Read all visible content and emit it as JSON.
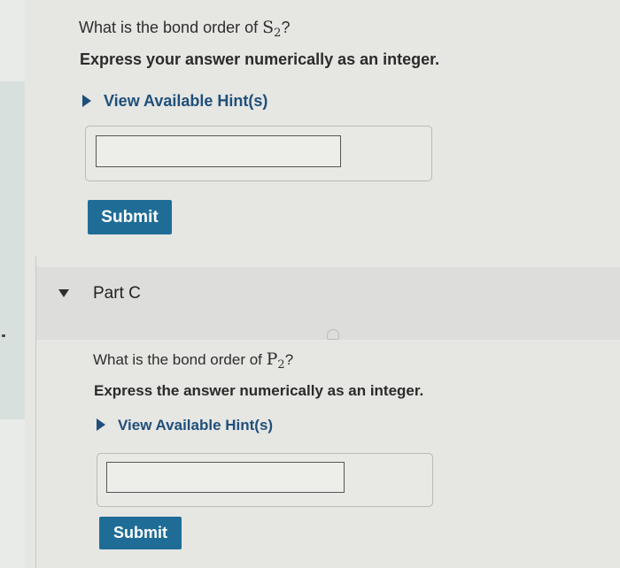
{
  "part_b": {
    "question_prefix": "What is the bond order of ",
    "formula_element": "S",
    "formula_subscript": "2",
    "question_suffix": "?",
    "instruction": "Express your answer numerically as an integer.",
    "hint_label": "View Available Hint(s)",
    "answer_value": "",
    "submit_label": "Submit"
  },
  "part_c": {
    "title": "Part C",
    "question_prefix": "What is the bond order of ",
    "formula_element": "P",
    "formula_subscript": "2",
    "question_suffix": "?",
    "instruction": "Express the answer numerically as an integer.",
    "hint_label": "View Available Hint(s)",
    "answer_value": "",
    "submit_label": "Submit"
  },
  "colors": {
    "submit_bg": "#1f6d96",
    "hint_text": "#1f4f7a",
    "page_bg": "#e6e6e3"
  }
}
